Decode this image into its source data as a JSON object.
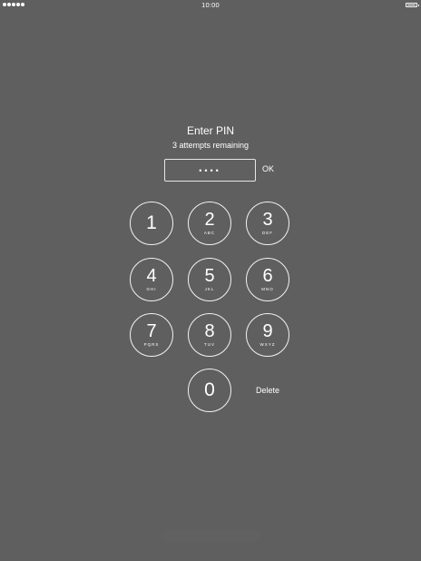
{
  "status_bar": {
    "time": "10:00",
    "signal_icon": "signal-dots-icon",
    "battery_icon": "battery-icon"
  },
  "prompt": {
    "title": "Enter PIN",
    "subtitle": "3 attempts remaining"
  },
  "pin_field": {
    "value": "••••",
    "masked_length": 4
  },
  "actions": {
    "ok_label": "OK",
    "delete_label": "Delete"
  },
  "keypad": {
    "keys": [
      {
        "digit": "1",
        "letters": ""
      },
      {
        "digit": "2",
        "letters": "ABC"
      },
      {
        "digit": "3",
        "letters": "DEF"
      },
      {
        "digit": "4",
        "letters": "GHI"
      },
      {
        "digit": "5",
        "letters": "JKL"
      },
      {
        "digit": "6",
        "letters": "MNO"
      },
      {
        "digit": "7",
        "letters": "PQRS"
      },
      {
        "digit": "8",
        "letters": "TUV"
      },
      {
        "digit": "9",
        "letters": "WXYZ"
      },
      {
        "digit": "0",
        "letters": ""
      }
    ]
  },
  "colors": {
    "background": "#5f5f5f",
    "foreground": "#ffffff"
  }
}
